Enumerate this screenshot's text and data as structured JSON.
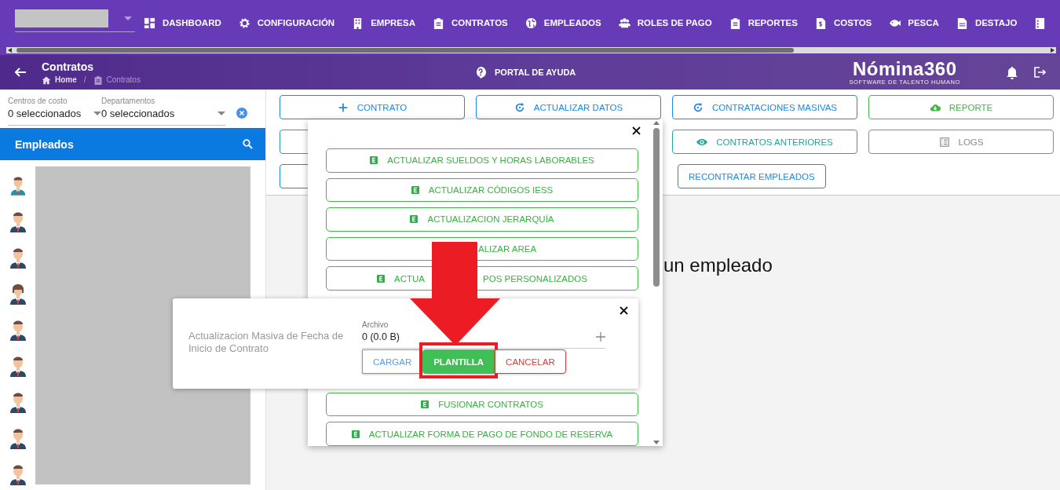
{
  "top_nav": {
    "items": [
      {
        "label": "DASHBOARD",
        "kind": "link"
      },
      {
        "label": "CONFIGURACIÓN",
        "kind": "link"
      },
      {
        "label": "EMPRESA",
        "kind": "link"
      },
      {
        "label": "CONTRATOS",
        "kind": "link"
      },
      {
        "label": "EMPLEADOS",
        "kind": "link"
      },
      {
        "label": "ROLES DE PAGO",
        "kind": "link"
      },
      {
        "label": "REPORTES",
        "kind": "link"
      },
      {
        "label": "COSTOS",
        "kind": "link"
      },
      {
        "label": "PESCA",
        "kind": "link"
      },
      {
        "label": "DESTAJO",
        "kind": "link"
      },
      {
        "kind": "icon"
      }
    ]
  },
  "header": {
    "title": "Contratos",
    "breadcrumb": [
      {
        "label": "Home"
      },
      {
        "label": "Contratos"
      }
    ],
    "breadcrumb_separator": "/",
    "help": "PORTAL DE AYUDA",
    "logo": {
      "name": "Nómina360",
      "tagline": "SOFTWARE DE TALENTO HUMANO"
    }
  },
  "filters": [
    {
      "label": "Centros de costo",
      "value": "0 seleccionados"
    },
    {
      "label": "Departamentos",
      "value": "0 seleccionados"
    }
  ],
  "employees": {
    "title": "Empleados",
    "items": [
      {
        "kind": "man-teal"
      },
      {
        "kind": "man"
      },
      {
        "kind": "man"
      },
      {
        "kind": "woman"
      },
      {
        "kind": "man"
      },
      {
        "kind": "man"
      },
      {
        "kind": "man"
      },
      {
        "kind": "man"
      },
      {
        "kind": "man"
      }
    ]
  },
  "toolbar": {
    "rows": [
      [
        {
          "label": "CONTRATO",
          "color": "#1e88e5"
        },
        {
          "label": "ACTUALIZAR DATOS",
          "color": "#1e88e5"
        },
        {
          "label": "CONTRATACIONES MASIVAS",
          "color": "#1e88e5"
        },
        {
          "label": "REPORTE",
          "color": "#43b649"
        }
      ],
      [
        {
          "color": "#26a69a"
        },
        "",
        {
          "label": "CONTRATOS ANTERIORES",
          "color": "#26a69a"
        },
        {
          "label": "LOGS",
          "color": "#8a8a8a"
        }
      ],
      [
        {
          "color": "#1e88e5"
        },
        "",
        {
          "label": "RECONTRATAR EMPLEADOS",
          "color": "#1e88e5",
          "kind": "compact"
        }
      ]
    ]
  },
  "empty_message": "un empleado",
  "menu": {
    "items": [
      {
        "label": "ACTUALIZAR SUELDOS Y HORAS LABORABLES",
        "kind": "full"
      },
      {
        "label": "ACTUALIZAR CÓDIGOS IESS",
        "kind": "full"
      },
      {
        "label": "ACTUALIZACION JERARQUÍA",
        "kind": "full"
      },
      {
        "label": "ALIZAR AREA",
        "kind": "partial"
      },
      {
        "label_parts": [
          "ACTUA",
          "POS PERSONALIZADOS"
        ],
        "kind": "split"
      }
    ],
    "items_after": [
      {
        "label": "FUSIONAR CONTRATOS",
        "kind": "full"
      },
      {
        "label": "ACTUALIZAR FORMA DE PAGO DE FONDO DE RESERVA",
        "kind": "full"
      }
    ]
  },
  "dialog": {
    "description": "Actualizacion Masiva de Fecha de Inicio de Contrato",
    "file_label": "Archivo",
    "file_value": "0 (0.0 B)",
    "buttons": [
      {
        "label": "CARGAR",
        "kind": "outline",
        "color": "#5a9ef0",
        "highlighted": false
      },
      {
        "label": "PLANTILLA",
        "kind": "filled",
        "color": "#3fbf55",
        "highlighted": true
      },
      {
        "label": "CANCELAR",
        "kind": "outline",
        "color": "#e53935",
        "highlighted": false
      }
    ]
  }
}
